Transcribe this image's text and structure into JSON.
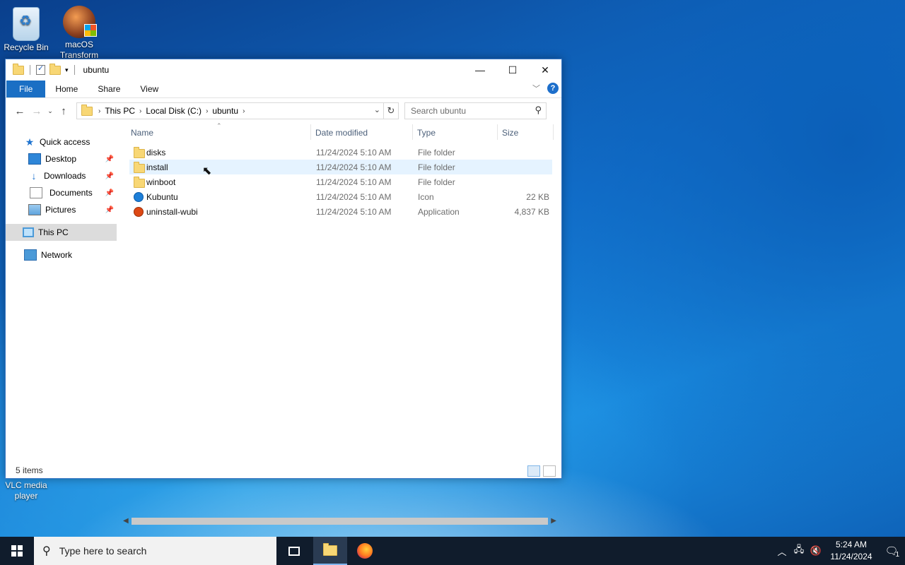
{
  "desktop": {
    "icons": [
      {
        "label": "Recycle Bin"
      },
      {
        "label": "macOS Transform"
      },
      {
        "label": "VLC media player"
      }
    ]
  },
  "window": {
    "title": "ubuntu",
    "controls": {
      "minimize": "—",
      "maximize": "☐",
      "close": "✕"
    }
  },
  "ribbon": {
    "tabs": [
      "File",
      "Home",
      "Share",
      "View"
    ],
    "help": "?"
  },
  "address": {
    "crumbs": [
      "This PC",
      "Local Disk (C:)",
      "ubuntu"
    ]
  },
  "search": {
    "placeholder": "Search ubuntu"
  },
  "nav": {
    "items": [
      {
        "label": "Quick access",
        "icon": "star-icon"
      },
      {
        "label": "Desktop",
        "icon": "desktop-icon",
        "pinned": true
      },
      {
        "label": "Downloads",
        "icon": "download-icon",
        "pinned": true
      },
      {
        "label": "Documents",
        "icon": "document-icon",
        "pinned": true
      },
      {
        "label": "Pictures",
        "icon": "pictures-icon",
        "pinned": true
      },
      {
        "label": "This PC",
        "icon": "computer-icon",
        "selected": true
      },
      {
        "label": "Network",
        "icon": "network-icon"
      }
    ]
  },
  "columns": {
    "name": "Name",
    "date": "Date modified",
    "type": "Type",
    "size": "Size"
  },
  "files": [
    {
      "name": "disks",
      "date": "11/24/2024 5:10 AM",
      "type": "File folder",
      "size": "",
      "icon": "folder-icon"
    },
    {
      "name": "install",
      "date": "11/24/2024 5:10 AM",
      "type": "File folder",
      "size": "",
      "icon": "folder-icon"
    },
    {
      "name": "winboot",
      "date": "11/24/2024 5:10 AM",
      "type": "File folder",
      "size": "",
      "icon": "folder-icon"
    },
    {
      "name": "Kubuntu",
      "date": "11/24/2024 5:10 AM",
      "type": "Icon",
      "size": "22 KB",
      "icon": "kubuntu-icon"
    },
    {
      "name": "uninstall-wubi",
      "date": "11/24/2024 5:10 AM",
      "type": "Application",
      "size": "4,837 KB",
      "icon": "ubuntu-app-icon"
    }
  ],
  "status": {
    "items_count": "5 items"
  },
  "taskbar": {
    "search_placeholder": "Type here to search",
    "time": "5:24 AM",
    "date": "11/24/2024",
    "notification_count": "1"
  }
}
